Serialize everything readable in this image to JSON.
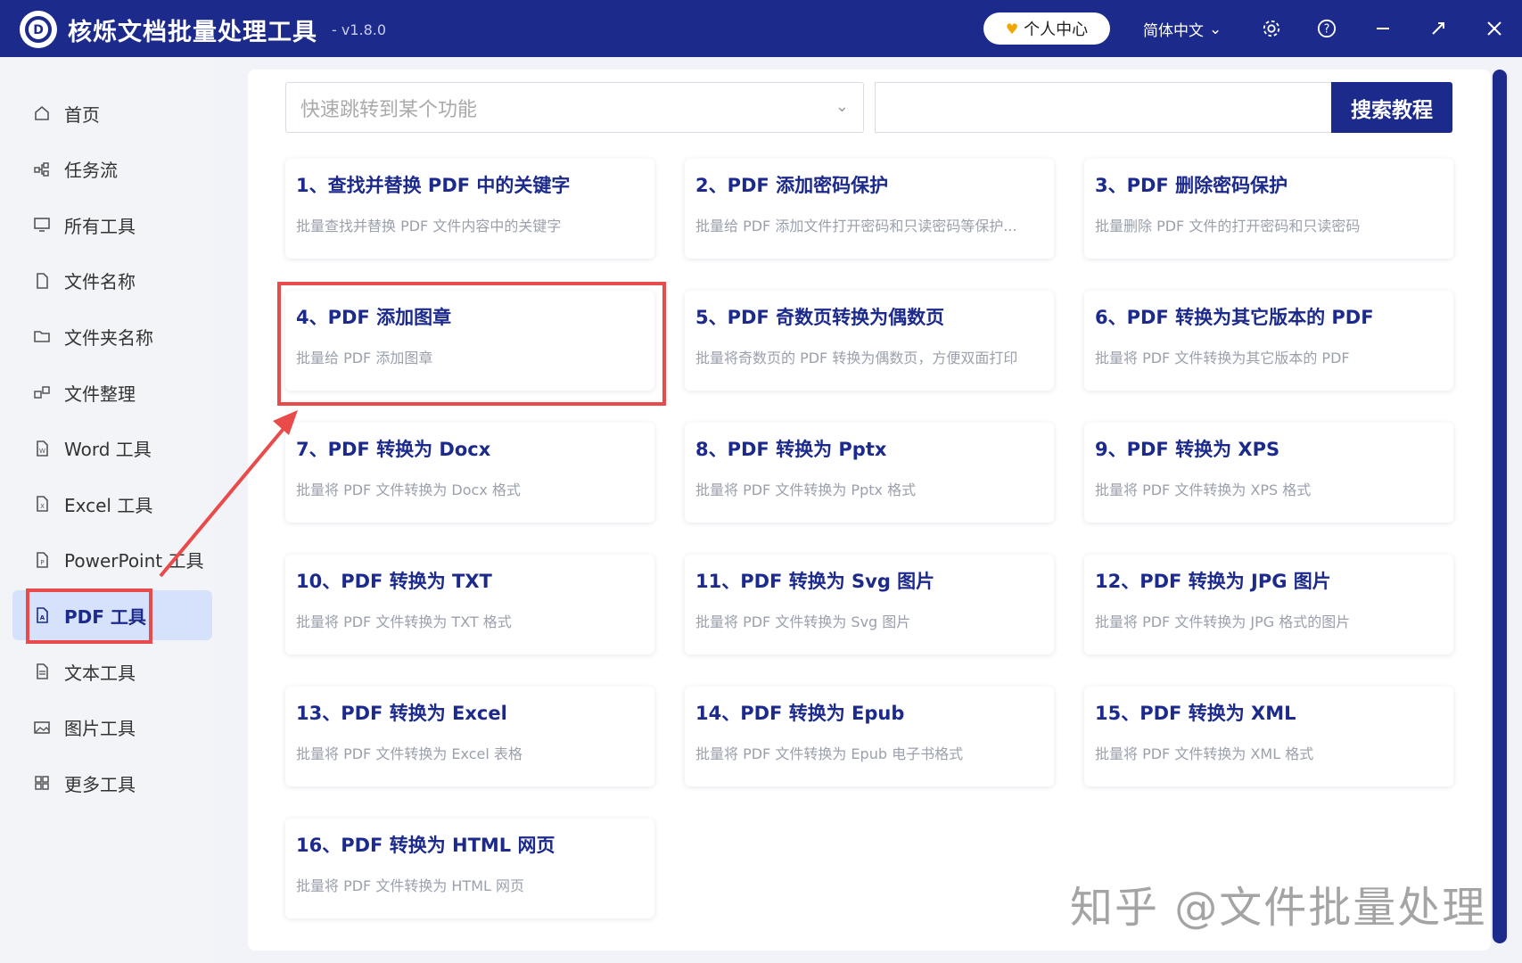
{
  "app": {
    "title": "核烁文档批量处理工具",
    "version": "- v1.8.0",
    "user_center": "个人中心",
    "language": "简体中文"
  },
  "sidebar": {
    "items": [
      {
        "label": "首页",
        "icon": "home-icon"
      },
      {
        "label": "任务流",
        "icon": "workflow-icon"
      },
      {
        "label": "所有工具",
        "icon": "monitor-icon"
      },
      {
        "label": "文件名称",
        "icon": "file-icon"
      },
      {
        "label": "文件夹名称",
        "icon": "folder-icon"
      },
      {
        "label": "文件整理",
        "icon": "organize-icon"
      },
      {
        "label": "Word 工具",
        "icon": "word-icon"
      },
      {
        "label": "Excel 工具",
        "icon": "excel-icon"
      },
      {
        "label": "PowerPoint 工具",
        "icon": "ppt-icon"
      },
      {
        "label": "PDF 工具",
        "icon": "pdf-icon"
      },
      {
        "label": "文本工具",
        "icon": "text-icon"
      },
      {
        "label": "图片工具",
        "icon": "image-icon"
      },
      {
        "label": "更多工具",
        "icon": "grid-icon"
      }
    ],
    "active_index": 9
  },
  "search": {
    "select_placeholder": "快速跳转到某个功能",
    "input_value": "",
    "button_label": "搜索教程"
  },
  "cards": [
    {
      "title": "1、查找并替换 PDF 中的关键字",
      "desc": "批量查找并替换 PDF 文件内容中的关键字"
    },
    {
      "title": "2、PDF 添加密码保护",
      "desc": "批量给 PDF 添加文件打开密码和只读密码等保护..."
    },
    {
      "title": "3、PDF 删除密码保护",
      "desc": "批量删除 PDF 文件的打开密码和只读密码"
    },
    {
      "title": "4、PDF 添加图章",
      "desc": "批量给 PDF 添加图章"
    },
    {
      "title": "5、PDF 奇数页转换为偶数页",
      "desc": "批量将奇数页的 PDF 转换为偶数页，方便双面打印"
    },
    {
      "title": "6、PDF 转换为其它版本的 PDF",
      "desc": "批量将 PDF 文件转换为其它版本的 PDF"
    },
    {
      "title": "7、PDF 转换为 Docx",
      "desc": "批量将 PDF 文件转换为 Docx 格式"
    },
    {
      "title": "8、PDF 转换为 Pptx",
      "desc": "批量将 PDF 文件转换为 Pptx 格式"
    },
    {
      "title": "9、PDF 转换为 XPS",
      "desc": "批量将 PDF 文件转换为 XPS 格式"
    },
    {
      "title": "10、PDF 转换为 TXT",
      "desc": "批量将 PDF 文件转换为 TXT 格式"
    },
    {
      "title": "11、PDF 转换为 Svg 图片",
      "desc": "批量将 PDF 文件转换为 Svg 图片"
    },
    {
      "title": "12、PDF 转换为 JPG 图片",
      "desc": "批量将 PDF 文件转换为 JPG 格式的图片"
    },
    {
      "title": "13、PDF 转换为 Excel",
      "desc": "批量将 PDF 文件转换为 Excel 表格"
    },
    {
      "title": "14、PDF 转换为 Epub",
      "desc": "批量将 PDF 文件转换为 Epub 电子书格式"
    },
    {
      "title": "15、PDF 转换为 XML",
      "desc": "批量将 PDF 文件转换为 XML 格式"
    },
    {
      "title": "16、PDF 转换为 HTML 网页",
      "desc": "批量将 PDF 文件转换为 HTML 网页"
    }
  ],
  "watermark": "知乎 @文件批量处理",
  "colors": {
    "brand": "#1c2a8c",
    "highlight": "#e94a4a",
    "active_bg": "#d6e2fb"
  }
}
